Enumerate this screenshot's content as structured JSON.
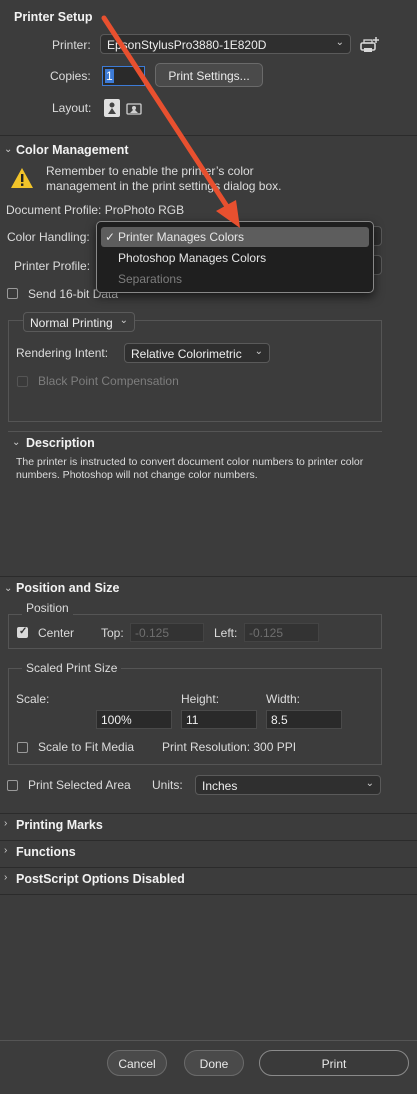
{
  "printer_setup": {
    "title": "Printer Setup",
    "printer_label": "Printer:",
    "printer_value": "EpsonStylusPro3880-1E820D",
    "copies_label": "Copies:",
    "copies_value": "1",
    "print_settings_button": "Print Settings...",
    "layout_label": "Layout:"
  },
  "color_management": {
    "title": "Color Management",
    "reminder": "Remember to enable the printer’s color management in the print settings dialog box.",
    "document_profile": "Document Profile: ProPhoto RGB",
    "color_handling_label": "Color Handling:",
    "printer_profile_label": "Printer Profile:",
    "send_16bit_label": "Send 16-bit Data",
    "normal_printing": "Normal Printing",
    "rendering_intent_label": "Rendering Intent:",
    "rendering_intent_value": "Relative Colorimetric",
    "black_point_label": "Black Point Compensation",
    "menu": {
      "items": [
        {
          "label": "Printer Manages Colors",
          "check": "✓"
        },
        {
          "label": "Photoshop Manages Colors"
        },
        {
          "label": "Separations"
        }
      ]
    }
  },
  "description": {
    "title": "Description",
    "text": "The printer is instructed to convert document color numbers to printer color numbers. Photoshop will not change color numbers."
  },
  "position_size": {
    "title": "Position and Size",
    "position_label": "Position",
    "center_label": "Center",
    "top_label": "Top:",
    "top_value": "-0.125",
    "left_label": "Left:",
    "left_value": "-0.125",
    "scaled_label": "Scaled Print Size",
    "scale_label": "Scale:",
    "height_label": "Height:",
    "width_label": "Width:",
    "scale_value": "100%",
    "height_value": "11",
    "width_value": "8.5",
    "scale_fit_label": "Scale to Fit Media",
    "resolution": "Print Resolution: 300 PPI",
    "print_selected_label": "Print Selected Area",
    "units_label": "Units:",
    "units_value": "Inches"
  },
  "sections": {
    "printing_marks": "Printing Marks",
    "functions": "Functions",
    "postscript": "PostScript Options Disabled"
  },
  "footer": {
    "cancel": "Cancel",
    "done": "Done",
    "print": "Print"
  },
  "annotation": {
    "arrow_color": "#e8502f"
  }
}
